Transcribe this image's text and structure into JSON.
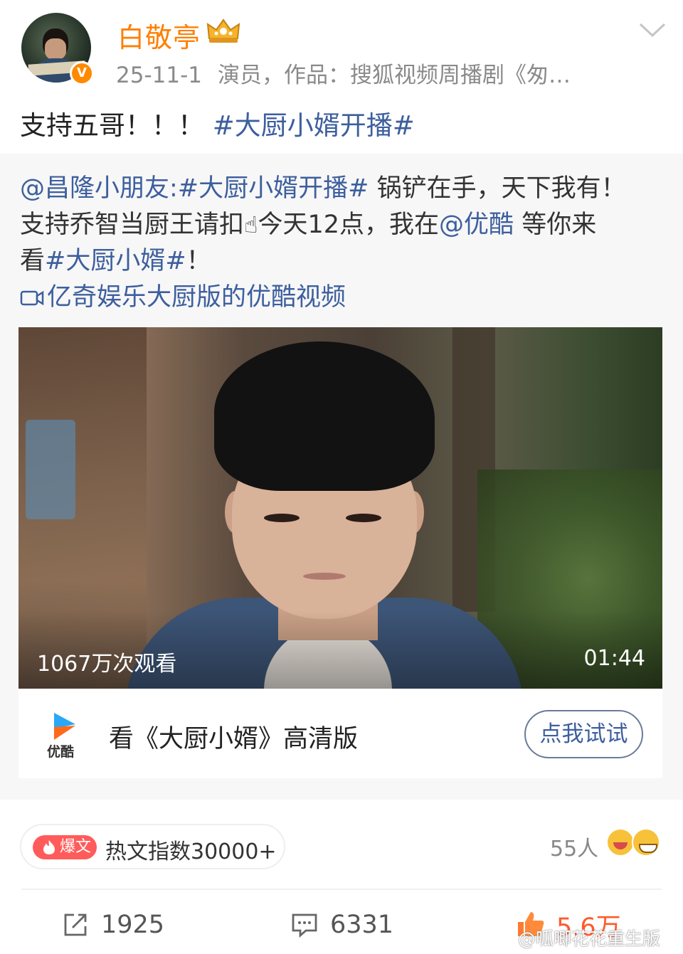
{
  "header": {
    "username": "白敬亭",
    "date": "25-11-1",
    "bio": "演员，作品：搜狐视频周播剧《匆…",
    "verified_badge": "V",
    "colors": {
      "username": "#ff7f00",
      "badge": "#ff8a00"
    }
  },
  "post": {
    "text": "支持五哥！！！",
    "hashtag": "#大厨小婿开播#"
  },
  "repost": {
    "line1_mention": "@昌隆小朋友",
    "line1_hashtag": ":#大厨小婿开播#",
    "line1_rest": " 锅铲在手，天下我有！",
    "line2_start": "支持乔智当厨王请扣",
    "line2_emoji": "☝",
    "line2_mid": "今天12点，我在",
    "line2_mention": "@优酷",
    "line2_end": " 等你来",
    "line3_start": "看",
    "line3_hashtag": "#大厨小婿#",
    "line3_end": "！",
    "video_link": "亿奇娱乐大厨版的优酷视频"
  },
  "video": {
    "views": "1067万次观看",
    "duration": "01:44"
  },
  "ad_card": {
    "logo_label": "优酷",
    "title": "看《大厨小婿》高清版",
    "button": "点我试试"
  },
  "stats_row": {
    "hot_tag": "爆文",
    "hot_text": "热文指数30000+",
    "people": "55人"
  },
  "actions": {
    "repost_count": "1925",
    "comment_count": "6331",
    "like_count": "5.6万"
  },
  "watermark": "@呱唧花花重生版",
  "icons": [
    "crown-icon",
    "chevron-down-icon",
    "video-icon",
    "youku-logo-icon",
    "flame-icon",
    "repost-icon",
    "comment-icon",
    "like-icon",
    "weibo-logo-icon"
  ],
  "colors": {
    "link": "#3d5f9e",
    "like": "#ff5a2a",
    "hot": "#ff5b5b"
  }
}
